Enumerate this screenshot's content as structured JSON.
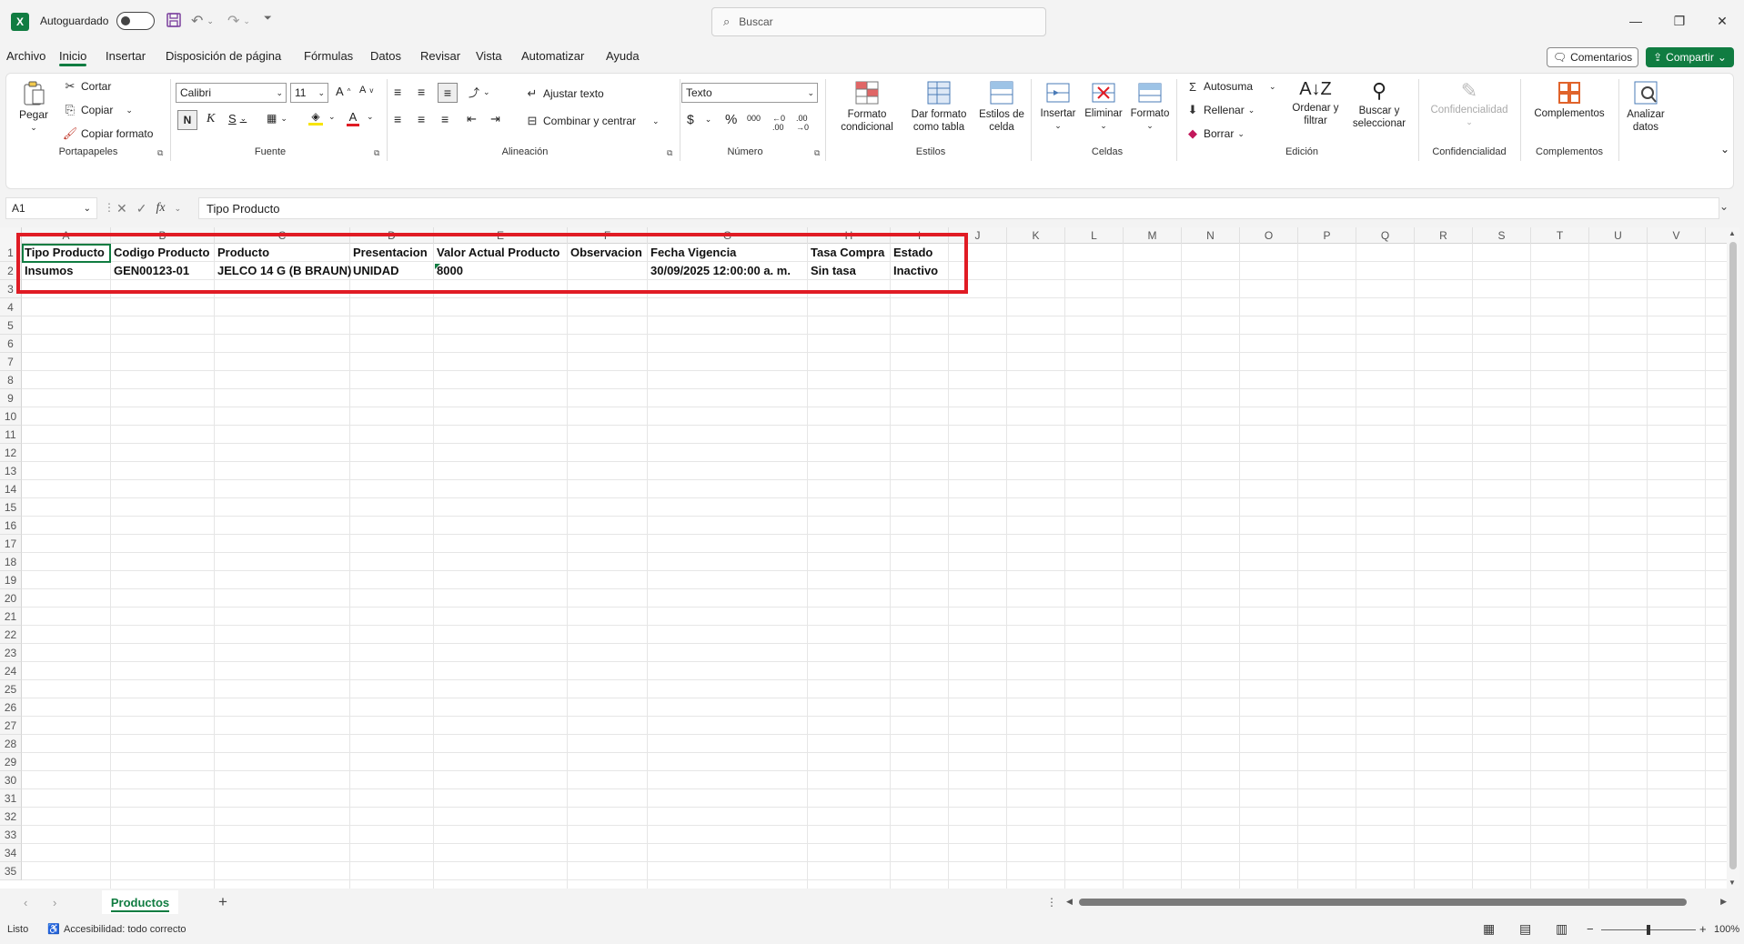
{
  "titlebar": {
    "autosave_label": "Autoguardado",
    "search_placeholder": "Buscar"
  },
  "menu": [
    "Archivo",
    "Inicio",
    "Insertar",
    "Disposición de página",
    "Fórmulas",
    "Datos",
    "Revisar",
    "Vista",
    "Automatizar",
    "Ayuda"
  ],
  "menu_active": "Inicio",
  "header_buttons": {
    "comments": "Comentarios",
    "share": "Compartir"
  },
  "ribbon": {
    "clipboard": {
      "paste": "Pegar",
      "cut": "Cortar",
      "copy": "Copiar",
      "format_painter": "Copiar formato",
      "label": "Portapapeles"
    },
    "font": {
      "name": "Calibri",
      "size": "11",
      "bold": "N",
      "italic": "K",
      "underline": "S",
      "label": "Fuente"
    },
    "alignment": {
      "wrap": "Ajustar texto",
      "merge": "Combinar y centrar",
      "label": "Alineación"
    },
    "number": {
      "format": "Texto",
      "label": "Número"
    },
    "styles": {
      "conditional": "Formato condicional",
      "as_table": "Dar formato como tabla",
      "cell_styles": "Estilos de celda",
      "label": "Estilos"
    },
    "cells": {
      "insert": "Insertar",
      "delete": "Eliminar",
      "format": "Formato",
      "label": "Celdas"
    },
    "editing": {
      "autosum": "Autosuma",
      "fill": "Rellenar",
      "clear": "Borrar",
      "sort_filter": "Ordenar y filtrar",
      "find_select": "Buscar y seleccionar",
      "label": "Edición"
    },
    "sensitivity": {
      "btn": "Confidencialidad",
      "label": "Confidencialidad"
    },
    "addins": {
      "btn": "Complementos",
      "label": "Complementos"
    },
    "analyze": {
      "btn": "Analizar datos"
    }
  },
  "formula_bar": {
    "name_box": "A1",
    "fx": "fx",
    "value": "Tipo Producto"
  },
  "columns": [
    "A",
    "B",
    "C",
    "D",
    "E",
    "F",
    "G",
    "H",
    "I",
    "J",
    "K",
    "L",
    "M",
    "N",
    "O",
    "P",
    "Q",
    "R",
    "S",
    "T",
    "U",
    "V"
  ],
  "rows": [
    "1",
    "2",
    "3",
    "4",
    "5",
    "6",
    "7",
    "8",
    "9",
    "10",
    "11",
    "12",
    "13",
    "14",
    "15",
    "16",
    "17",
    "18",
    "19",
    "20",
    "21",
    "22",
    "23",
    "24",
    "25",
    "26",
    "27",
    "28",
    "29",
    "30",
    "31",
    "32",
    "33",
    "34",
    "35"
  ],
  "table": {
    "headers": [
      "Tipo Producto",
      "Codigo Producto",
      "Producto",
      "Presentacion",
      "Valor Actual Producto",
      "Observacion",
      "Fecha Vigencia",
      "Tasa Compra",
      "Estado"
    ],
    "row2": [
      "Insumos",
      "GEN00123-01",
      "JELCO 14 G (B BRAUN)",
      "UNIDAD",
      "8000",
      "",
      "30/09/2025 12:00:00 a. m.",
      "Sin tasa",
      "Inactivo"
    ]
  },
  "sheet": {
    "tab": "Productos",
    "add": "+"
  },
  "status": {
    "ready": "Listo",
    "accessibility": "Accesibilidad: todo correcto",
    "zoom": "100%"
  },
  "colors": {
    "accent": "#107c41",
    "highlight": "#e01b24"
  }
}
